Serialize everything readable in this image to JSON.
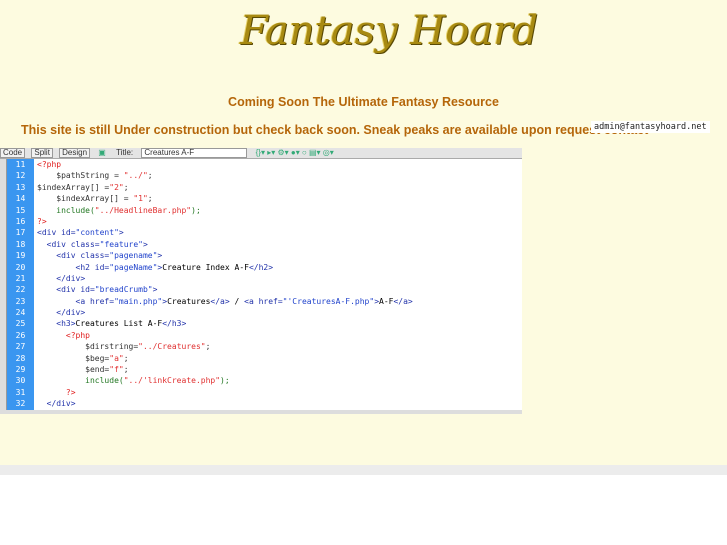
{
  "logo_text": "Fantasy Hoard",
  "headline": "Coming Soon The Ultimate Fantasy Resource",
  "notice": "This site is still Under construction but check back soon. Sneak peaks are available upon request contact",
  "email": "admin@fantasyhoard.net",
  "editor": {
    "toolbar": {
      "code": "Code",
      "split": "Split",
      "design": "Design",
      "title_label": "Title:",
      "title_value": "Creatures A-F"
    },
    "lines": [
      {
        "n": "11",
        "segs": [
          [
            "php",
            "<?php"
          ]
        ]
      },
      {
        "n": "12",
        "segs": [
          [
            "var",
            "    $pathString = "
          ],
          [
            "red",
            "\"../\""
          ],
          [
            "var",
            ";"
          ]
        ]
      },
      {
        "n": "13",
        "segs": [
          [
            "var",
            "$indexArray[] ="
          ],
          [
            "red",
            "\"2\""
          ],
          [
            "var",
            ";"
          ]
        ]
      },
      {
        "n": "14",
        "segs": [
          [
            "var",
            "    $indexArray[] = "
          ],
          [
            "red",
            "\"1\""
          ],
          [
            "var",
            ";"
          ]
        ]
      },
      {
        "n": "15",
        "segs": [
          [
            "fn",
            "    include("
          ],
          [
            "red",
            "\"../HeadlineBar.php\""
          ],
          [
            "fn",
            ");"
          ]
        ]
      },
      {
        "n": "16",
        "segs": [
          [
            "php",
            "?>"
          ]
        ]
      },
      {
        "n": "17",
        "segs": [
          [
            "tag",
            "<div id="
          ],
          [
            "str",
            "\"content\""
          ],
          [
            "tag",
            ">"
          ]
        ]
      },
      {
        "n": "18",
        "segs": [
          [
            "tag",
            "  <div class="
          ],
          [
            "str",
            "\"feature\""
          ],
          [
            "tag",
            ">"
          ]
        ]
      },
      {
        "n": "19",
        "segs": [
          [
            "tag",
            "    <div class="
          ],
          [
            "str",
            "\"pagename\""
          ],
          [
            "tag",
            ">"
          ]
        ]
      },
      {
        "n": "20",
        "segs": [
          [
            "tag",
            "        <h2 id="
          ],
          [
            "str",
            "\"pageName\""
          ],
          [
            "tag",
            ">"
          ],
          [
            "txt",
            "Creature Index A-F"
          ],
          [
            "tag",
            "</h2>"
          ]
        ]
      },
      {
        "n": "21",
        "segs": [
          [
            "tag",
            "    </div>"
          ]
        ]
      },
      {
        "n": "22",
        "segs": [
          [
            "tag",
            "    <div id="
          ],
          [
            "str",
            "\"breadCrumb\""
          ],
          [
            "tag",
            ">"
          ]
        ]
      },
      {
        "n": "23",
        "segs": [
          [
            "tag",
            "        <a href="
          ],
          [
            "str",
            "\"main.php\""
          ],
          [
            "tag",
            ">"
          ],
          [
            "txt",
            "Creatures"
          ],
          [
            "tag",
            "</a>"
          ],
          [
            "txt",
            " / "
          ],
          [
            "tag",
            "<a href="
          ],
          [
            "str",
            "\"'CreaturesA-F.php\""
          ],
          [
            "tag",
            ">"
          ],
          [
            "txt",
            "A-F"
          ],
          [
            "tag",
            "</a>"
          ]
        ]
      },
      {
        "n": "24",
        "segs": [
          [
            "tag",
            "    </div>"
          ]
        ]
      },
      {
        "n": "25",
        "segs": [
          [
            "tag",
            "    <h3>"
          ],
          [
            "txt",
            "Creatures List A-F"
          ],
          [
            "tag",
            "</h3>"
          ]
        ]
      },
      {
        "n": "26",
        "segs": [
          [
            "php",
            "      <?php"
          ]
        ]
      },
      {
        "n": "27",
        "segs": [
          [
            "var",
            "          $dirstring="
          ],
          [
            "red",
            "\"../Creatures\""
          ],
          [
            "var",
            ";"
          ]
        ]
      },
      {
        "n": "28",
        "segs": [
          [
            "var",
            "          $beg="
          ],
          [
            "red",
            "\"a\""
          ],
          [
            "var",
            ";"
          ]
        ]
      },
      {
        "n": "29",
        "segs": [
          [
            "var",
            "          $end="
          ],
          [
            "red",
            "\"f\""
          ],
          [
            "var",
            ";"
          ]
        ]
      },
      {
        "n": "30",
        "segs": [
          [
            "fn",
            "          include("
          ],
          [
            "red",
            "\"../'linkCreate.php\""
          ],
          [
            "fn",
            ");"
          ]
        ]
      },
      {
        "n": "31",
        "segs": [
          [
            "php",
            "      ?>"
          ]
        ]
      },
      {
        "n": "32",
        "segs": [
          [
            "tag",
            "  </div>"
          ]
        ]
      }
    ]
  }
}
